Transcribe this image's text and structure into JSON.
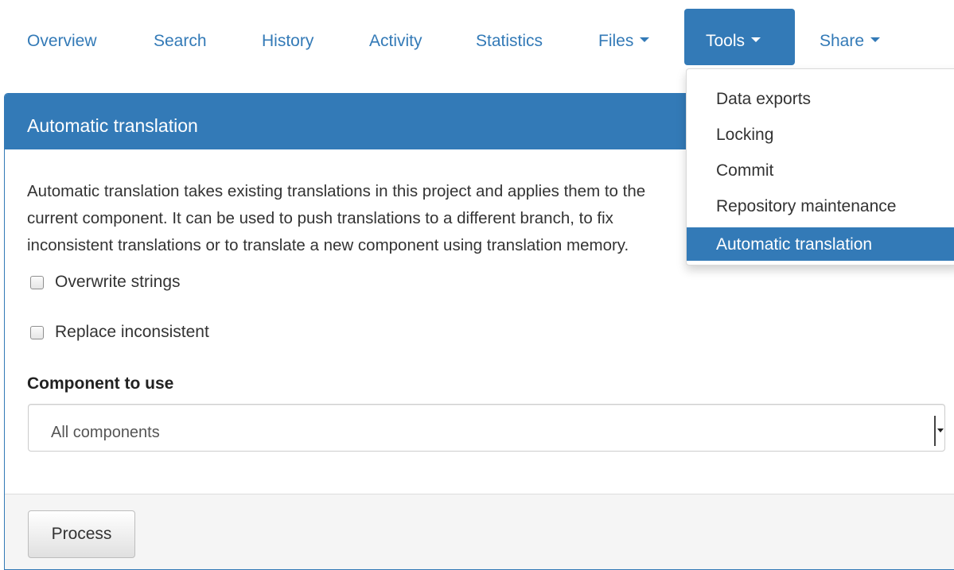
{
  "nav": {
    "tabs": [
      {
        "label": "Overview"
      },
      {
        "label": "Search"
      },
      {
        "label": "History"
      },
      {
        "label": "Activity"
      },
      {
        "label": "Statistics"
      },
      {
        "label": "Files"
      },
      {
        "label": "Tools"
      },
      {
        "label": "Share"
      }
    ],
    "active_tab": "Tools"
  },
  "tools_menu": {
    "items": [
      {
        "label": "Data exports"
      },
      {
        "label": "Locking"
      },
      {
        "label": "Commit"
      },
      {
        "label": "Repository maintenance"
      },
      {
        "label": "Automatic translation"
      }
    ],
    "active_item": "Automatic translation"
  },
  "panel": {
    "title": "Automatic translation",
    "description": "Automatic translation takes existing translations in this project and applies them to the current component. It can be used to push translations to a different branch, to fix inconsistent translations or to translate a new component using translation memory.",
    "options": [
      {
        "label": "Overwrite strings",
        "checked": false
      },
      {
        "label": "Replace inconsistent",
        "checked": false
      }
    ],
    "component_label": "Component to use",
    "component_selected": "All components",
    "submit_label": "Process"
  },
  "colors": {
    "primary": "#337ab7",
    "text": "#333333",
    "footer_bg": "#f5f5f5"
  }
}
